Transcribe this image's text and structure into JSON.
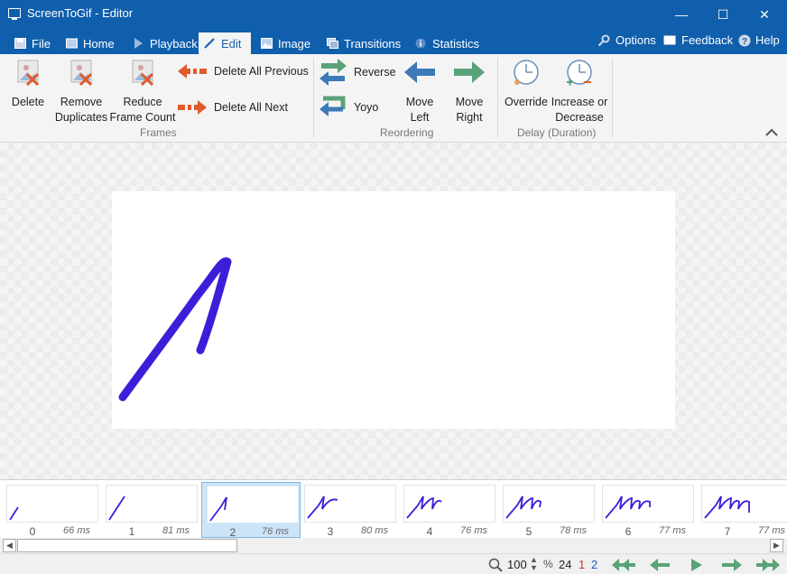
{
  "window": {
    "title": "ScreenToGif - Editor",
    "minimize": "—",
    "maximize": "☐",
    "close": "✕"
  },
  "tabs": [
    {
      "label": "File",
      "icon": "save-icon"
    },
    {
      "label": "Home",
      "icon": "home-icon"
    },
    {
      "label": "Playback",
      "icon": "play-icon"
    },
    {
      "label": "Edit",
      "icon": "pencil-icon",
      "active": true
    },
    {
      "label": "Image",
      "icon": "image-icon"
    },
    {
      "label": "Transitions",
      "icon": "transitions-icon"
    },
    {
      "label": "Statistics",
      "icon": "info-icon"
    }
  ],
  "right_tabs": {
    "options": "Options",
    "feedback": "Feedback",
    "help": "Help"
  },
  "ribbon": {
    "frames": {
      "label": "Frames",
      "delete": "Delete",
      "remove_duplicates": "Remove\nDuplicates",
      "reduce_frame_count": "Reduce\nFrame Count",
      "delete_all_previous": "Delete All Previous",
      "delete_all_next": "Delete All Next"
    },
    "reordering": {
      "label": "Reordering",
      "reverse": "Reverse",
      "yoyo": "Yoyo",
      "move_left": "Move\nLeft",
      "move_right": "Move\nRight"
    },
    "delay": {
      "label": "Delay (Duration)",
      "override": "Override",
      "increase_decrease": "Increase or\nDecrease"
    }
  },
  "frames": [
    {
      "number": "0",
      "delay": "66 ms"
    },
    {
      "number": "1",
      "delay": "81 ms"
    },
    {
      "number": "2",
      "delay": "76 ms",
      "selected": true
    },
    {
      "number": "3",
      "delay": "80 ms"
    },
    {
      "number": "4",
      "delay": "76 ms"
    },
    {
      "number": "5",
      "delay": "78 ms"
    },
    {
      "number": "6",
      "delay": "77 ms"
    },
    {
      "number": "7",
      "delay": "77 ms"
    }
  ],
  "status": {
    "zoom": "100",
    "zoom_unit": "%",
    "frame_count": "24",
    "selected_count": "1",
    "current_frame": "2"
  },
  "colors": {
    "titlebar": "#0f5fad",
    "stroke": "#3b1fd8",
    "arrow_red": "#e05a2b",
    "arrow_blue": "#3d7ab8",
    "arrow_green": "#5aa37a"
  }
}
